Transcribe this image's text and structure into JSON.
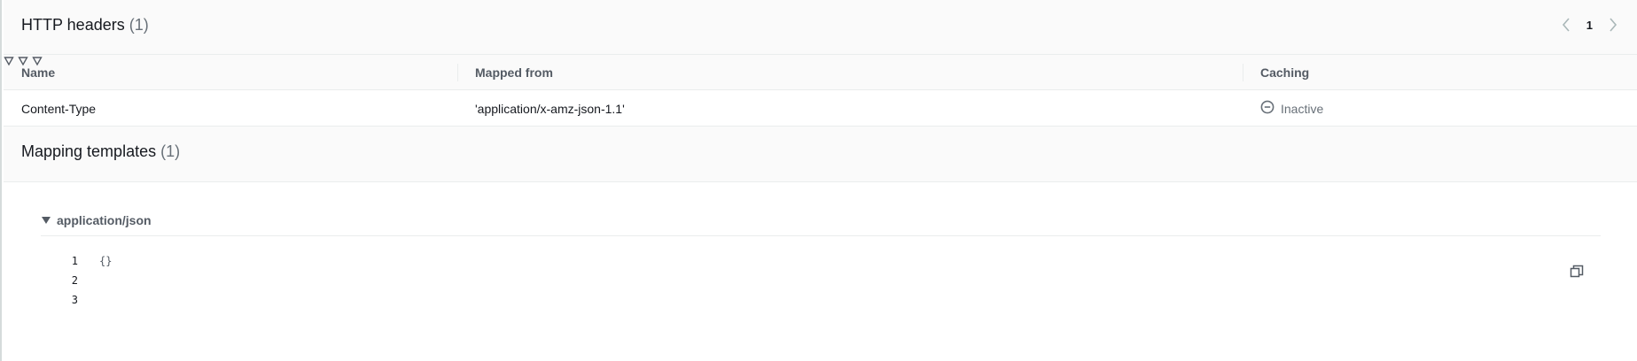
{
  "http_headers": {
    "title": "HTTP headers",
    "count": "(1)",
    "pagination": {
      "current_page": "1"
    },
    "columns": [
      "Name",
      "Mapped from",
      "Caching"
    ],
    "rows": [
      {
        "name": "Content-Type",
        "mapped_from": "'application/x-amz-json-1.1'",
        "caching": "Inactive"
      }
    ]
  },
  "mapping_templates": {
    "title": "Mapping templates",
    "count": "(1)",
    "expander_label": "application/json",
    "code_lines": [
      {
        "num": "1",
        "text": "{}"
      },
      {
        "num": "2",
        "text": ""
      },
      {
        "num": "3",
        "text": ""
      }
    ]
  },
  "icons": {
    "prev": "chevron-left-icon",
    "next": "chevron-right-icon",
    "sort": "sort-down-icon",
    "status": "minus-circle-icon",
    "expand": "caret-down-icon",
    "copy": "copy-icon"
  },
  "colors": {
    "header_bg": "#fafafa",
    "border": "#eaeded",
    "muted_text": "#687078",
    "text": "#16191f"
  }
}
